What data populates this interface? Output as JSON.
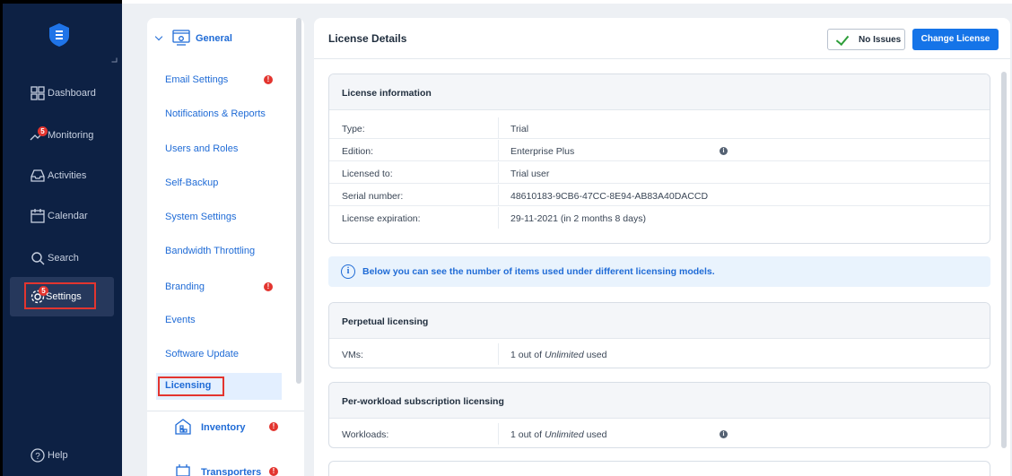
{
  "sidebar": {
    "items": [
      {
        "label": "Dashboard",
        "icon": "dashboard-icon"
      },
      {
        "label": "Monitoring",
        "icon": "monitoring-icon",
        "badge": "5"
      },
      {
        "label": "Activities",
        "icon": "inbox-icon"
      },
      {
        "label": "Calendar",
        "icon": "calendar-icon"
      },
      {
        "label": "Search",
        "icon": "search-icon"
      },
      {
        "label": "Settings",
        "icon": "gear-icon",
        "badge": "5"
      },
      {
        "label": "Help",
        "icon": "help-icon"
      }
    ]
  },
  "categories": {
    "general": {
      "label": "General",
      "items": [
        {
          "label": "Email Settings",
          "warning": "!"
        },
        {
          "label": "Notifications & Reports"
        },
        {
          "label": "Users and Roles"
        },
        {
          "label": "Self-Backup"
        },
        {
          "label": "System Settings"
        },
        {
          "label": "Bandwidth Throttling"
        },
        {
          "label": "Branding",
          "warning": "!"
        },
        {
          "label": "Events"
        },
        {
          "label": "Software Update"
        },
        {
          "label": "Licensing"
        }
      ]
    },
    "inventory": {
      "label": "Inventory",
      "warning": "!"
    },
    "transporters": {
      "label": "Transporters",
      "warning": "!"
    }
  },
  "main": {
    "title": "License Details",
    "status_label": "No Issues",
    "change_label": "Change License",
    "license_info": {
      "title": "License information",
      "rows": [
        {
          "key": "Type:",
          "value": "Trial"
        },
        {
          "key": "Edition:",
          "value": "Enterprise Plus"
        },
        {
          "key": "Licensed to:",
          "value": "Trial user"
        },
        {
          "key": "Serial number:",
          "value": "48610183-9CB6-47CC-8E94-AB83A40DACCD"
        },
        {
          "key": "License expiration:",
          "value": "29-11-2021 (in 2 months 8 days)"
        }
      ]
    },
    "notice": "Below you can see the number of items used under different licensing models.",
    "perpetual": {
      "title": "Perpetual licensing",
      "row": {
        "key": "VMs:",
        "pre": "1 out of ",
        "em": "Unlimited",
        "post": " used"
      }
    },
    "subscription": {
      "title": "Per-workload subscription licensing",
      "row": {
        "key": "Workloads:",
        "pre": "1 out of ",
        "em": "Unlimited",
        "post": " used"
      }
    }
  },
  "colors": {
    "rail_bg": "#0d2144",
    "accent": "#1574e8",
    "link": "#1f6bd6",
    "alert": "#e3352f",
    "ok": "#2e9e3a"
  }
}
